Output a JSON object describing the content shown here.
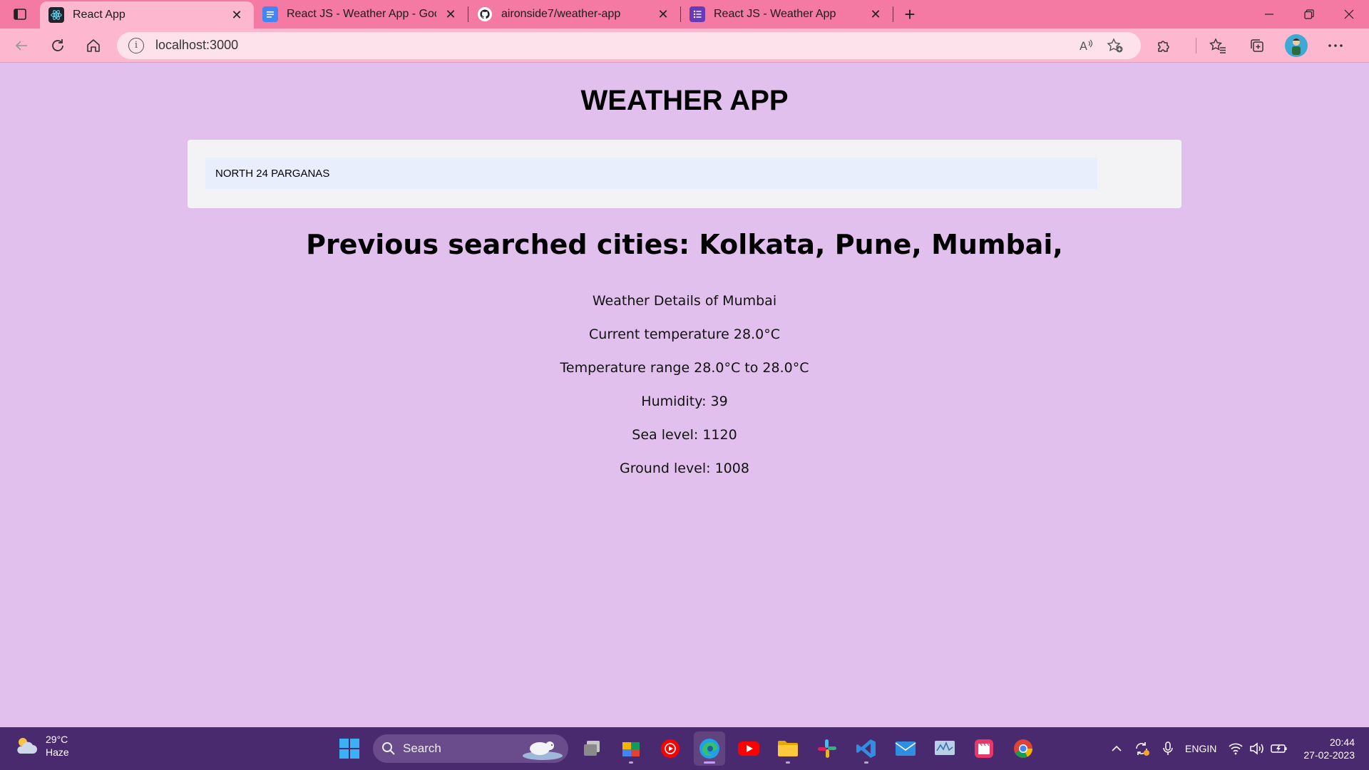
{
  "browser": {
    "tabs": [
      {
        "title": "React App",
        "active": true,
        "favicon": "react-icon"
      },
      {
        "title": "React JS - Weather App - Google",
        "active": false,
        "favicon": "google-docs-icon"
      },
      {
        "title": "aironside7/weather-app",
        "active": false,
        "favicon": "github-icon"
      },
      {
        "title": "React JS - Weather App",
        "active": false,
        "favicon": "forms-icon"
      }
    ],
    "url": "localhost:3000"
  },
  "app": {
    "title": "WEATHER APP",
    "search_value": "NORTH 24 PARGANAS",
    "previous_cities": "Previous searched cities: Kolkata, Pune, Mumbai,",
    "details": {
      "heading": "Weather Details of Mumbai",
      "current_temp": "Current temperature 28.0°C",
      "temp_range": "Temperature range 28.0°C to 28.0°C",
      "humidity": "Humidity: 39",
      "sea_level": "Sea level: 1120",
      "ground_level": "Ground level: 1008"
    }
  },
  "taskbar": {
    "weather_temp": "29°C",
    "weather_desc": "Haze",
    "search_label": "Search",
    "lang_line1": "ENG",
    "lang_line2": "IN",
    "time": "20:44",
    "date": "27-02-2023"
  },
  "colors": {
    "page_bg": "#e2c0ee",
    "tabstrip_bg": "#f47aa4",
    "toolbar_bg": "#fdb8cf",
    "taskbar_bg": "#4a2a6e"
  }
}
